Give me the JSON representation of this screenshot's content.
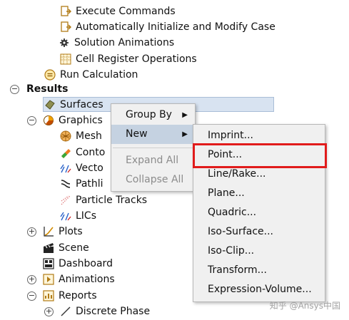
{
  "tree": {
    "execute_commands": "Execute Commands",
    "auto_init": "Automatically Initialize and Modify Case",
    "solution_animations": "Solution Animations",
    "cell_register": "Cell Register Operations",
    "run_calculation": "Run Calculation",
    "results": "Results",
    "surfaces": "Surfaces",
    "graphics": "Graphics",
    "mesh": "Mesh",
    "contours": "Conto",
    "vectors": "Vecto",
    "pathlines": "Pathli",
    "particle_tracks": "Particle Tracks",
    "lics": "LICs",
    "plots": "Plots",
    "scene": "Scene",
    "dashboard": "Dashboard",
    "animations": "Animations",
    "reports": "Reports",
    "discrete_phase": "Discrete Phase",
    "expand_glyph": "+",
    "collapse_glyph": "−"
  },
  "context_menu": {
    "group_by": "Group By",
    "new": "New",
    "expand_all": "Expand All",
    "collapse_all": "Collapse All",
    "submenu_arrow": "▶"
  },
  "submenu": {
    "items": [
      "Imprint...",
      "Point...",
      "Line/Rake...",
      "Plane...",
      "Quadric...",
      "Iso-Surface...",
      "Iso-Clip...",
      "Transform...",
      "Expression-Volume..."
    ],
    "highlighted": "Point..."
  },
  "watermark": "知乎 @Ansys中国",
  "colors": {
    "selection": "#d8e3f1",
    "menu_background": "#f0f0f0",
    "menu_highlight": "#c5d2e1",
    "callout_red": "#e11b1b"
  }
}
